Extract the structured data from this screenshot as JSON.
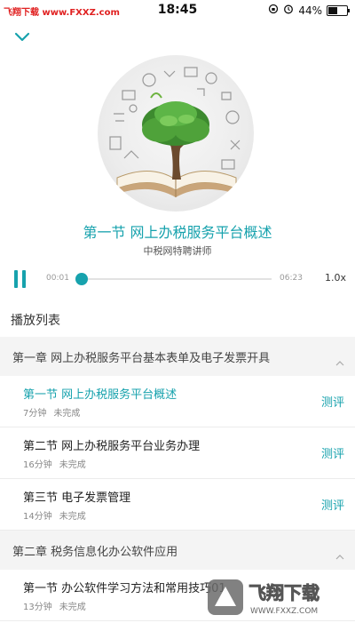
{
  "status_bar": {
    "watermark": "飞翔下载 www.FXXZ.com",
    "time": "18:45",
    "battery_text": "44%",
    "battery_level": 0.44
  },
  "player": {
    "lesson_title": "第一节 网上办税服务平台概述",
    "lecturer": "中税网特聘讲师",
    "current_time": "00:01",
    "total_time": "06:23",
    "progress": 0.003,
    "speed": "1.0x"
  },
  "playlist": {
    "heading": "播放列表",
    "chapters": [
      {
        "title": "第一章 网上办税服务平台基本表单及电子发票开具",
        "sections": [
          {
            "title": "第一节 网上办税服务平台概述",
            "duration": "7分钟",
            "status": "未完成",
            "action": "测评"
          },
          {
            "title": "第二节 网上办税服务平台业务办理",
            "duration": "16分钟",
            "status": "未完成",
            "action": "测评"
          },
          {
            "title": "第三节 电子发票管理",
            "duration": "14分钟",
            "status": "未完成",
            "action": "测评"
          }
        ]
      },
      {
        "title": "第二章 税务信息化办公软件应用",
        "sections": [
          {
            "title": "第一节 办公软件学习方法和常用技巧01",
            "duration": "13分钟",
            "status": "未完成",
            "action": ""
          }
        ]
      }
    ]
  },
  "site_logo": {
    "name": "飞翔下载",
    "url": "WWW.FXXZ.COM"
  },
  "colors": {
    "accent": "#17a2ad",
    "chapter_bg": "#f4f4f4"
  },
  "icons": [
    "collapse-chevron-icon",
    "pause-icon",
    "chevron-up-icon",
    "alarm-icon",
    "lock-rotation-icon"
  ]
}
